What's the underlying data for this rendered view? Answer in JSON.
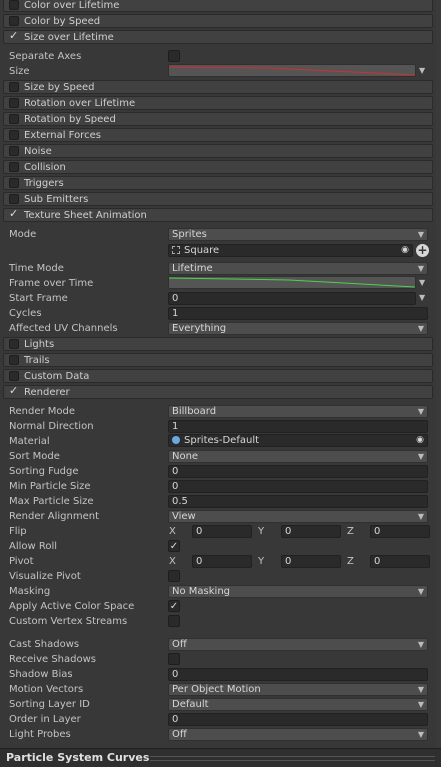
{
  "modules_top": [
    {
      "label": "Color over Lifetime",
      "checked": false
    },
    {
      "label": "Color by Speed",
      "checked": false
    },
    {
      "label": "Size over Lifetime",
      "checked": true
    }
  ],
  "size_over_lifetime": {
    "separate_axes_label": "Separate Axes",
    "size_label": "Size"
  },
  "modules_mid": [
    {
      "label": "Size by Speed",
      "checked": false
    },
    {
      "label": "Rotation over Lifetime",
      "checked": false
    },
    {
      "label": "Rotation by Speed",
      "checked": false
    },
    {
      "label": "External Forces",
      "checked": false
    },
    {
      "label": "Noise",
      "checked": false
    },
    {
      "label": "Collision",
      "checked": false
    },
    {
      "label": "Triggers",
      "checked": false
    },
    {
      "label": "Sub Emitters",
      "checked": false
    },
    {
      "label": "Texture Sheet Animation",
      "checked": true
    }
  ],
  "texture_sheet": {
    "mode_label": "Mode",
    "mode_value": "Sprites",
    "sprite_value": "Square",
    "time_mode_label": "Time Mode",
    "time_mode_value": "Lifetime",
    "frame_over_time_label": "Frame over Time",
    "start_frame_label": "Start Frame",
    "start_frame_value": "0",
    "cycles_label": "Cycles",
    "cycles_value": "1",
    "uv_label": "Affected UV Channels",
    "uv_value": "Everything"
  },
  "modules_low": [
    {
      "label": "Lights",
      "checked": false
    },
    {
      "label": "Trails",
      "checked": false
    },
    {
      "label": "Custom Data",
      "checked": false
    },
    {
      "label": "Renderer",
      "checked": true
    }
  ],
  "renderer": {
    "render_mode_label": "Render Mode",
    "render_mode_value": "Billboard",
    "normal_direction_label": "Normal Direction",
    "normal_direction_value": "1",
    "material_label": "Material",
    "material_value": "Sprites-Default",
    "sort_mode_label": "Sort Mode",
    "sort_mode_value": "None",
    "sorting_fudge_label": "Sorting Fudge",
    "sorting_fudge_value": "0",
    "min_size_label": "Min Particle Size",
    "min_size_value": "0",
    "max_size_label": "Max Particle Size",
    "max_size_value": "0.5",
    "alignment_label": "Render Alignment",
    "alignment_value": "View",
    "flip_label": "Flip",
    "flip_x": "0",
    "flip_y": "0",
    "flip_z": "0",
    "allow_roll_label": "Allow Roll",
    "pivot_label": "Pivot",
    "pivot_x": "0",
    "pivot_y": "0",
    "pivot_z": "0",
    "visualize_pivot_label": "Visualize Pivot",
    "masking_label": "Masking",
    "masking_value": "No Masking",
    "active_color_label": "Apply Active Color Space",
    "custom_streams_label": "Custom Vertex Streams",
    "cast_shadows_label": "Cast Shadows",
    "cast_shadows_value": "Off",
    "receive_shadows_label": "Receive Shadows",
    "shadow_bias_label": "Shadow Bias",
    "shadow_bias_value": "0",
    "motion_vectors_label": "Motion Vectors",
    "motion_vectors_value": "Per Object Motion",
    "sorting_layer_label": "Sorting Layer ID",
    "sorting_layer_value": "Default",
    "order_label": "Order in Layer",
    "order_value": "0",
    "light_probes_label": "Light Probes",
    "light_probes_value": "Off"
  },
  "axes": {
    "x": "X",
    "y": "Y",
    "z": "Z"
  },
  "footer": {
    "title": "Particle System Curves"
  }
}
